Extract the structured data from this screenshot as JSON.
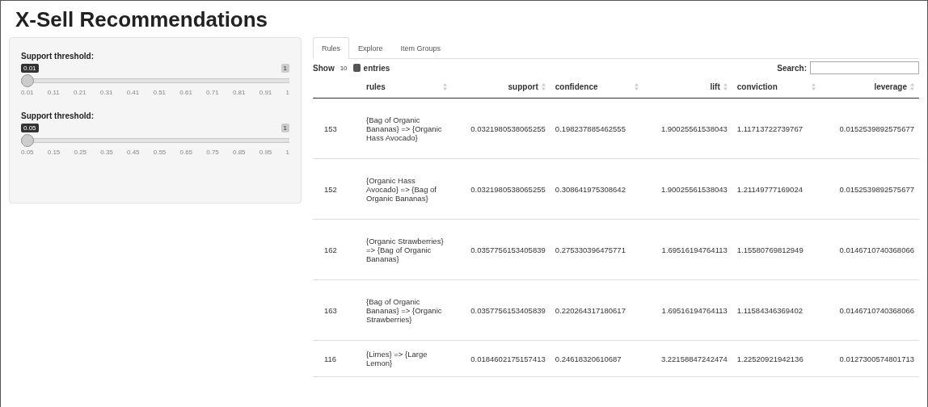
{
  "title": "X-Sell Recommendations",
  "sliders": [
    {
      "label": "Support threshold:",
      "value": "0.01",
      "max_label": "1",
      "level": 0,
      "ticks": [
        "0.01",
        "0.11",
        "0.21",
        "0.31",
        "0.41",
        "0.51",
        "0.61",
        "0.71",
        "0.81",
        "0.91",
        "1"
      ]
    },
    {
      "label": "Support threshold:",
      "value": "0.05",
      "max_label": "1",
      "level": 0,
      "ticks": [
        "0.05",
        "0.15",
        "0.25",
        "0.35",
        "0.45",
        "0.55",
        "0.65",
        "0.75",
        "0.85",
        "0.95",
        "1"
      ]
    }
  ],
  "tabs": [
    {
      "label": "Rules",
      "selected": true
    },
    {
      "label": "Explore",
      "selected": false
    },
    {
      "label": "Item Groups",
      "selected": false
    }
  ],
  "length": {
    "show": "Show",
    "value": "10",
    "entries": "entries"
  },
  "search": {
    "label": "Search:"
  },
  "table": {
    "columns": [
      "rules",
      "support",
      "confidence",
      "lift",
      "conviction",
      "leverage"
    ],
    "rows": [
      {
        "index": "153",
        "cells": [
          "{Bag of Organic Bananas} => {Organic Hass Avocado}",
          "0.0321980538065255",
          "0.198237885462555",
          "1.90025561538043",
          "1.11713722739767",
          "0.0152539892575677"
        ]
      },
      {
        "index": "152",
        "cells": [
          "{Organic Hass Avocado} => {Bag of Organic Bananas}",
          "0.0321980538065255",
          "0.308641975308642",
          "1.90025561538043",
          "1.21149777169024",
          "0.0152539892575677"
        ]
      },
      {
        "index": "162",
        "cells": [
          "{Organic Strawberries} => {Bag of Organic Bananas}",
          "0.0357756153405839",
          "0.275330396475771",
          "1.69516194764113",
          "1.15580769812949",
          "0.0146710740368066"
        ]
      },
      {
        "index": "163",
        "cells": [
          "{Bag of Organic Bananas} => {Organic Strawberries}",
          "0.0357756153405839",
          "0.220264317180617",
          "1.69516194764113",
          "1.11584346369402",
          "0.0146710740368066"
        ]
      },
      {
        "index": "116",
        "cells": [
          "{Limes} => {Large Lemon}",
          "0.0184602175157413",
          "0.24618320610687",
          "3.22158847242474",
          "1.22520921942136",
          "0.0127300574801713"
        ]
      }
    ]
  }
}
